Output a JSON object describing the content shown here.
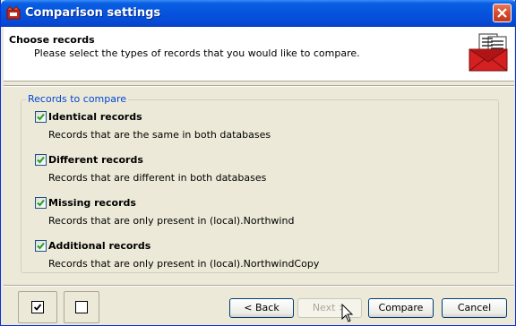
{
  "window": {
    "title": "Comparison settings"
  },
  "header": {
    "title": "Choose records",
    "subtitle": "Please select the types of records that you would like to compare."
  },
  "group": {
    "legend": "Records to compare",
    "options": [
      {
        "label": "Identical records",
        "description": "Records that are the same in both databases",
        "checked": true
      },
      {
        "label": "Different records",
        "description": "Records that are different in both databases",
        "checked": true
      },
      {
        "label": "Missing records",
        "description": "Records that are only present in (local).Northwind",
        "checked": true
      },
      {
        "label": "Additional records",
        "description": "Records that are only present in (local).NorthwindCopy",
        "checked": true
      }
    ]
  },
  "footer": {
    "select_all_icon": "checked-box-icon",
    "select_none_icon": "empty-box-icon",
    "back_label": "< Back",
    "next_label": "Next >",
    "compare_label": "Compare",
    "cancel_label": "Cancel"
  },
  "colors": {
    "title_blue": "#0553dd",
    "legend_blue": "#0046d5",
    "close_red": "#d04a2b",
    "envelope_red": "#d42020"
  }
}
